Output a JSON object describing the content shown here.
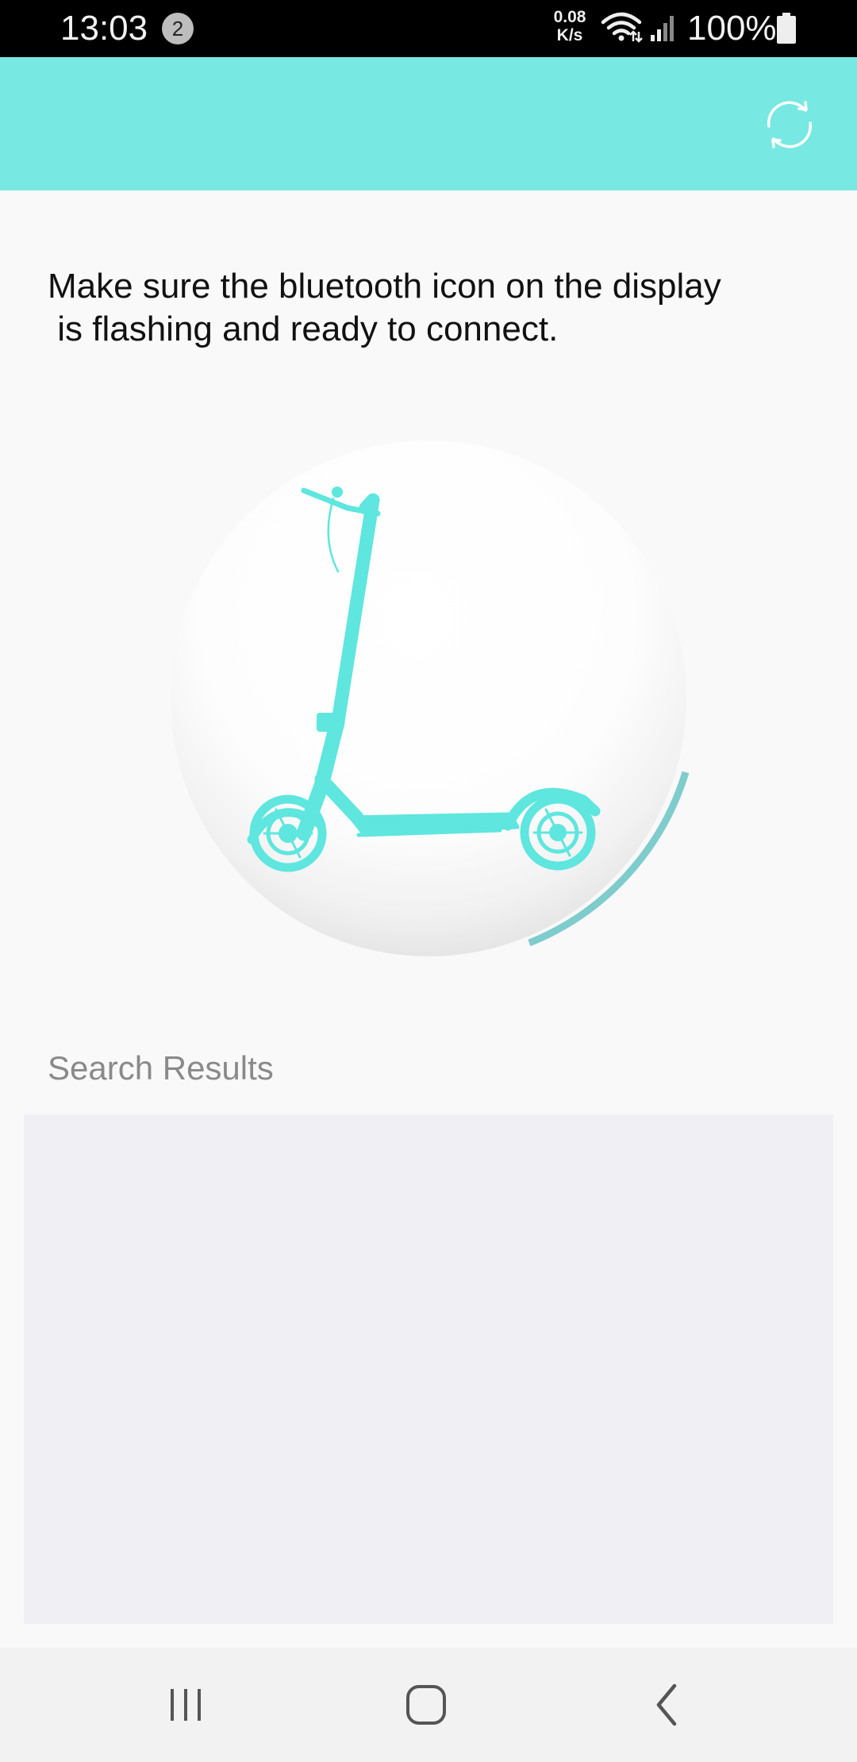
{
  "status_bar": {
    "time": "13:03",
    "notification_count": "2",
    "net_speed_value": "0.08",
    "net_speed_unit": "K/s",
    "battery": "100%",
    "icons": [
      "wifi-icon",
      "signal-icon",
      "battery-icon"
    ]
  },
  "header": {
    "background_color": "#78e8e2",
    "refresh_icon": "refresh-icon"
  },
  "main": {
    "instruction": "Make sure the bluetooth icon on the display\n is flashing and ready to connect.",
    "scanner": {
      "illustration": "scooter-illustration",
      "accent_color": "#5ee6df",
      "ring_color": "#7fcccc"
    },
    "results_title": "Search Results",
    "results": []
  },
  "nav_bar": {
    "buttons": [
      "recent-apps-button",
      "home-button",
      "back-button"
    ]
  }
}
